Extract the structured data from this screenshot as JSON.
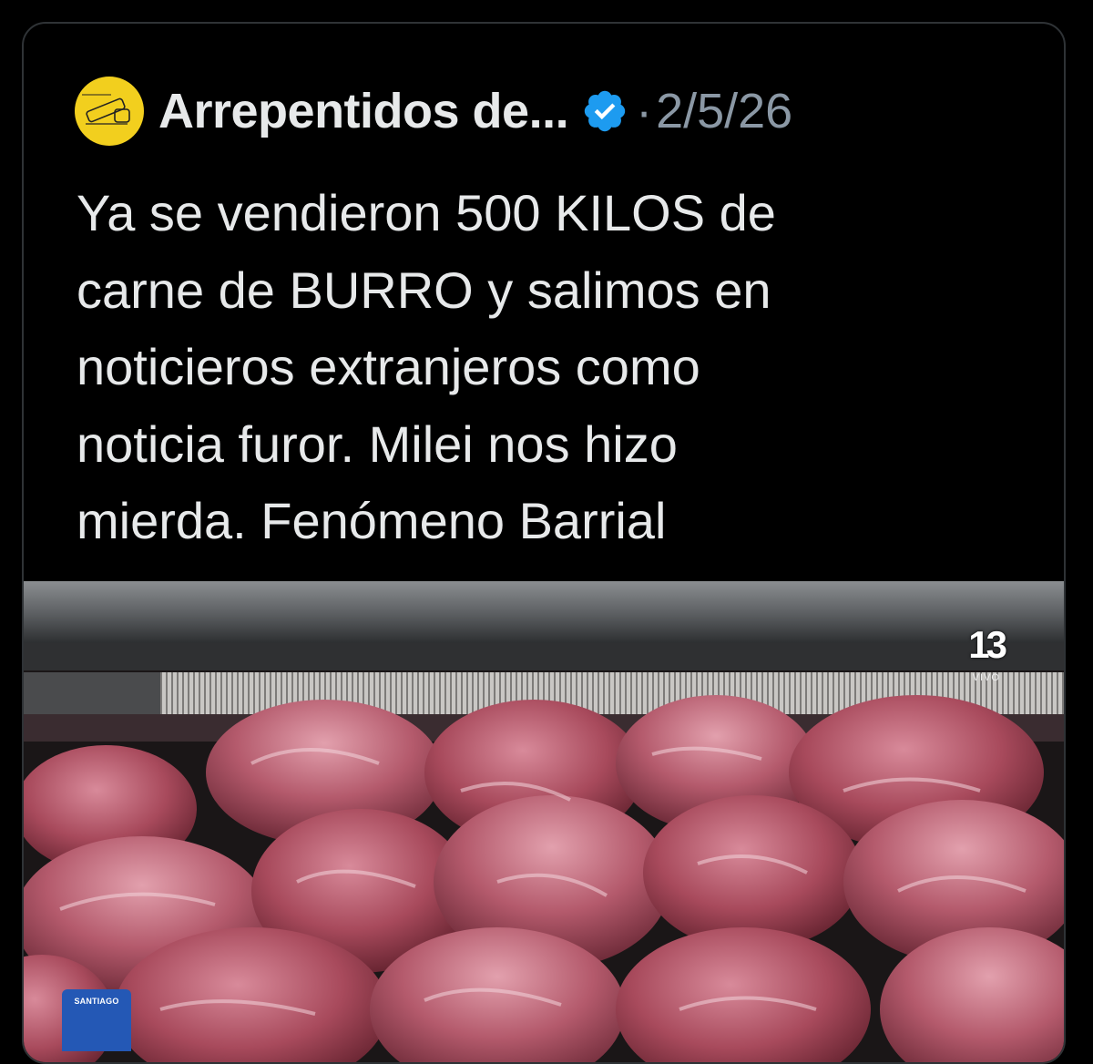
{
  "tweet": {
    "author": "Arrepentidos de...",
    "separator": "·",
    "date": "2/5/26",
    "text": "Ya se vendieron 500 KILOS de\ncarne de BURRO y salimos en\nnoticieros extranjeros como\nnoticia furor. Milei nos hizo\nmierda. Fenómeno Barrial",
    "avatar_color": "#f2cf1e",
    "verified_color": "#1d9bf0"
  },
  "media": {
    "channel_logo": "13",
    "live_label": "VIVO",
    "corner_badge": "SANTIAGO"
  }
}
